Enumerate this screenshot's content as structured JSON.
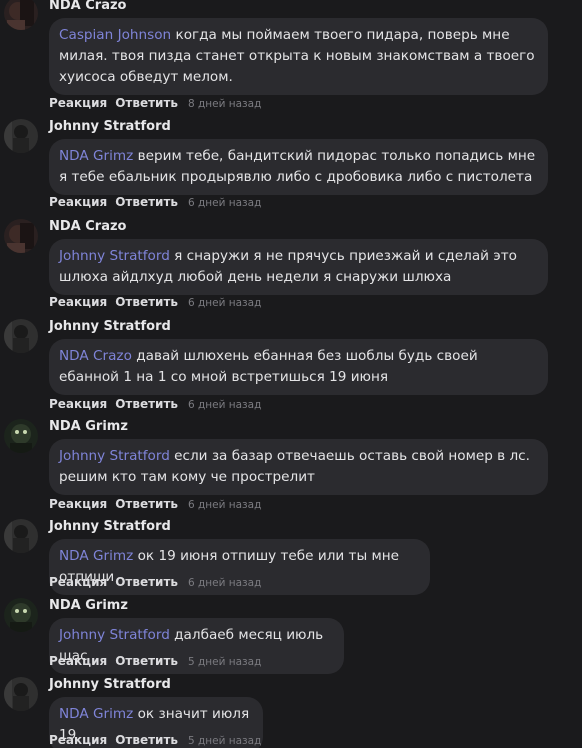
{
  "labels": {
    "reaction": "Реакция",
    "reply": "Ответить"
  },
  "comments": [
    {
      "author": "NDA Crazo",
      "mention": "Caspian Johnson",
      "text": " когда мы поймаем твоего пидара, поверь мне милая. твоя пизда станет открыта к новым знакомствам а твоего хуисоса обведут мелом.",
      "time": "8 дней назад",
      "avatar": "crazo"
    },
    {
      "author": "Johnny Stratford",
      "mention": "NDA Grimz",
      "text": " верим тебе, бандитский пидорас только попадись мне я тебе ебальник продырявлю либо с дробовика либо с пистолета",
      "time": "6 дней назад",
      "avatar": "stratford"
    },
    {
      "author": "NDA Crazo",
      "mention": "Johnny Stratford",
      "text": " я снаружи я не прячусь приезжай и сделай это шлюха айдлхуд любой день недели я снаружи шлюха",
      "time": "6 дней назад",
      "avatar": "crazo"
    },
    {
      "author": "Johnny Stratford",
      "mention": "NDA Crazo",
      "text": " давай шлюхень ебанная без шоблы будь своей ебанной 1 на 1 со мной встретишься 19 июня",
      "time": "6 дней назад",
      "avatar": "stratford"
    },
    {
      "author": "NDA Grimz",
      "mention": "Johnny Stratford",
      "text": " если за базар отвечаешь оставь свой номер в лс. решим кто там кому че прострелит",
      "time": "6 дней назад",
      "avatar": "grimz"
    },
    {
      "author": "Johnny Stratford",
      "mention": "NDA Grimz",
      "text": " ок 19 июня отпишу тебе или ты мне отпиши",
      "time": "6 дней назад",
      "avatar": "stratford"
    },
    {
      "author": "NDA Grimz",
      "mention": "Johnny Stratford",
      "text": " далбаеб месяц июль щас",
      "time": "5 дней назад",
      "avatar": "grimz"
    },
    {
      "author": "Johnny Stratford",
      "mention": "NDA Grimz",
      "text": " ок значит июля 19",
      "time": "5 дней назад",
      "avatar": "stratford"
    }
  ]
}
